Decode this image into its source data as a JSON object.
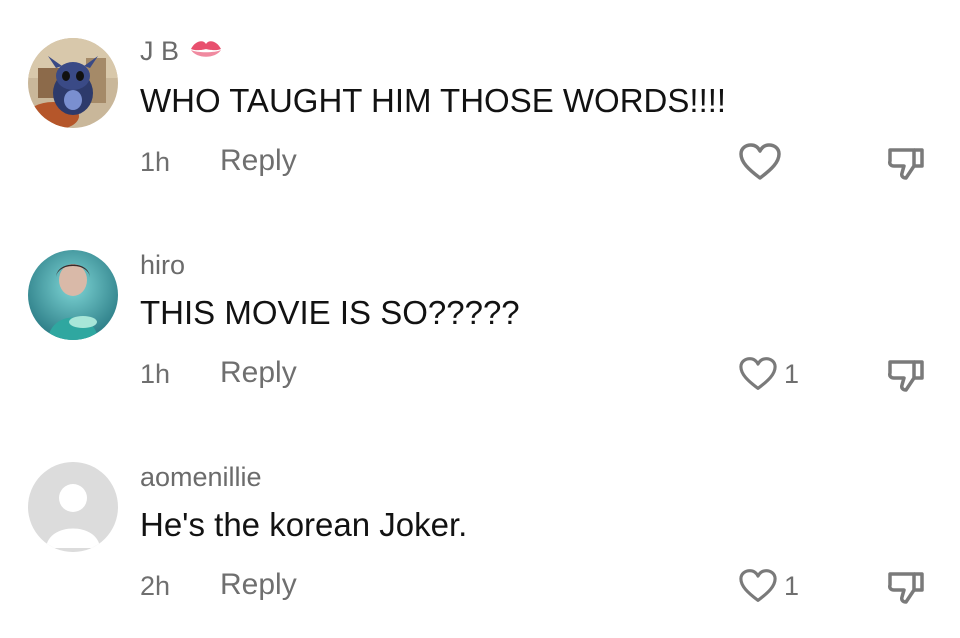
{
  "comments": [
    {
      "username": "J B",
      "username_emoji_icon": "kiss-mark-icon",
      "text": "WHO TAUGHT HIM THOSE WORDS!!!!",
      "time": "1h",
      "reply_label": "Reply",
      "like_count": "",
      "avatar": "cartoon-character-avatar"
    },
    {
      "username": "hiro",
      "text": "THIS MOVIE IS SO?????",
      "time": "1h",
      "reply_label": "Reply",
      "like_count": "1",
      "avatar": "photo-avatar"
    },
    {
      "username": "aomenillie",
      "text": "He's the korean Joker.",
      "time": "2h",
      "reply_label": "Reply",
      "like_count": "1",
      "avatar": "default-avatar"
    }
  ],
  "colors": {
    "username": "#6b6b6b",
    "text": "#121212",
    "meta": "#6f6f6f",
    "icon_stroke": "#7a7a7a",
    "kiss": "#e8506e"
  }
}
